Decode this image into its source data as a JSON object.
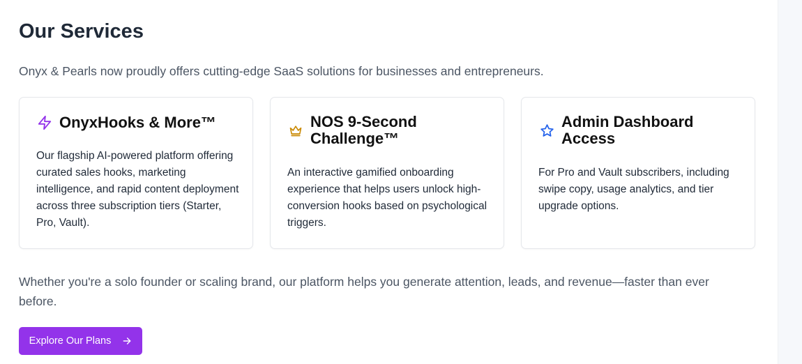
{
  "header": {
    "title": "Our Services",
    "intro": "Onyx & Pearls now proudly offers cutting-edge SaaS solutions for businesses and entrepreneurs."
  },
  "services": [
    {
      "title": "OnyxHooks & More™",
      "icon": "lightning-icon",
      "icon_color": "#9333ea",
      "description": "Our flagship AI-powered platform offering curated sales hooks, marketing intelligence, and rapid content deployment across three subscription tiers (Starter, Pro, Vault)."
    },
    {
      "title": "NOS 9-Second Challenge™",
      "icon": "crown-icon",
      "icon_color": "#ca8a04",
      "description": "An interactive gamified onboarding experience that helps users unlock high-conversion hooks based on psychological triggers."
    },
    {
      "title": "Admin Dashboard Access",
      "icon": "star-icon",
      "icon_color": "#2563eb",
      "description": "For Pro and Vault subscribers, including swipe copy, usage analytics, and tier upgrade options."
    }
  ],
  "outro": "Whether you're a solo founder or scaling brand, our platform helps you generate attention, leads, and revenue—faster than ever before.",
  "cta": {
    "label": "Explore Our Plans",
    "icon": "arrow-right-icon",
    "color": "#9333ea"
  }
}
